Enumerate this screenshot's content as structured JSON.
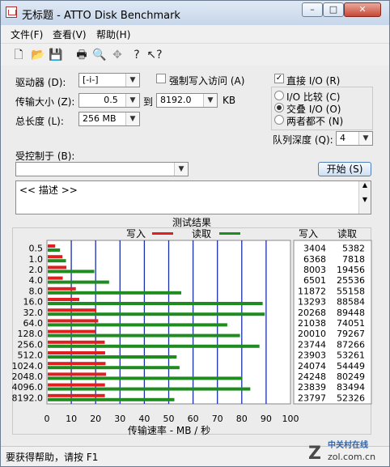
{
  "window": {
    "title": "无标题 - ATTO Disk Benchmark",
    "min_label": "–",
    "max_label": "□",
    "close_label": "✕"
  },
  "menu": [
    "文件(F)",
    "查看(V)",
    "帮助(H)"
  ],
  "toolbar_icons": [
    "new-file-icon",
    "open-folder-icon",
    "save-icon",
    "print-icon",
    "print-preview-icon",
    "move-icon",
    "help-icon",
    "context-help-icon"
  ],
  "settings": {
    "drive_label": "驱动器 (D):",
    "drive_value": "[-i-]",
    "force_write_label": "强制写入访问 (A)",
    "direct_io_label": "直接 I/O (R)",
    "transfer_label": "传输大小 (Z):",
    "transfer_from": "0.5",
    "to_label": "到",
    "transfer_to": "8192.0",
    "kb_label": "KB",
    "io_compare_label": "I/O 比较 (C)",
    "overlap_io_label": "交叠 I/O (O)",
    "neither_label": "两者都不 (N)",
    "total_length_label": "总长度 (L):",
    "total_length_value": "256 MB",
    "queue_depth_label": "队列深度 (Q):",
    "queue_depth_value": "4",
    "controlled_by_label": "受控制于 (B):",
    "controlled_by_value": "",
    "start_button": "开始 (S)",
    "description": "<< 描述 >>"
  },
  "chart_data": {
    "type": "bar",
    "title": "测试结果",
    "xlabel": "传输速率 - MB / 秒",
    "ylabel": "",
    "xlim": [
      0,
      100
    ],
    "xticks": [
      0,
      10,
      20,
      30,
      40,
      50,
      60,
      70,
      80,
      90,
      100
    ],
    "categories": [
      "0.5",
      "1.0",
      "2.0",
      "4.0",
      "8.0",
      "16.0",
      "32.0",
      "64.0",
      "128.0",
      "256.0",
      "512.0",
      "1024.0",
      "2048.0",
      "4096.0",
      "8192.0"
    ],
    "series": [
      {
        "name": "写入",
        "color": "#e02020",
        "values": [
          3404,
          6368,
          8003,
          6501,
          11872,
          13293,
          20268,
          21038,
          20010,
          23744,
          23903,
          24074,
          24248,
          23839,
          23797
        ]
      },
      {
        "name": "读取",
        "color": "#1e8c1e",
        "values": [
          5382,
          7818,
          19456,
          25536,
          55158,
          88584,
          89448,
          74051,
          79267,
          87266,
          53261,
          54449,
          80249,
          83494,
          52326
        ]
      }
    ],
    "column_headers": [
      "写入",
      "读取"
    ],
    "value_unit_scale": 1000,
    "grid": true
  },
  "status": {
    "text": "要获得帮助，请按 F1",
    "watermark_cn": "中关村在线",
    "watermark_url": "zol.com.cn"
  },
  "colors": {
    "grid_blue": "#1b2fa8",
    "write_red": "#e02020",
    "read_green": "#1e8c1e"
  }
}
